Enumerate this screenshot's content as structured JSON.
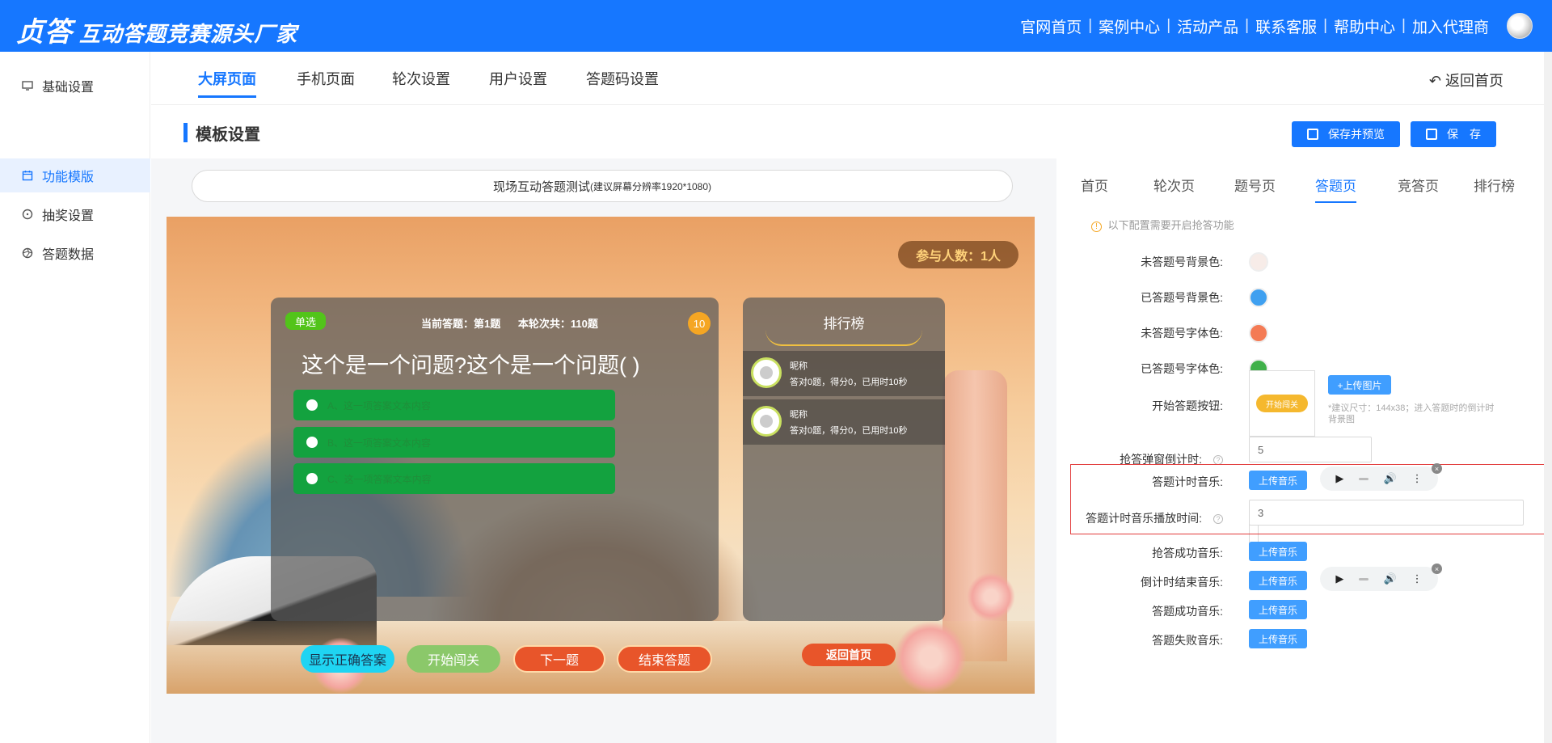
{
  "header": {
    "brand": "贞答",
    "slogan": "互动答题竞赛源头厂家",
    "nav": [
      "官网首页",
      "案例中心",
      "活动产品",
      "联系客服",
      "帮助中心",
      "加入代理商"
    ],
    "separator": "|"
  },
  "sidebar": {
    "items": [
      {
        "label": "基础设置",
        "icon": "monitor-icon"
      },
      {
        "label": "功能模版",
        "icon": "calendar-icon"
      },
      {
        "label": "抽奖设置",
        "icon": "dial-icon"
      },
      {
        "label": "答题数据",
        "icon": "aperture-icon"
      }
    ]
  },
  "tabs": [
    "大屏页面",
    "手机页面",
    "轮次设置",
    "用户设置",
    "答题码设置"
  ],
  "back_home": "返回首页",
  "section_title": "模板设置",
  "actions": {
    "save_preview": "保存并预览",
    "save": "保　存"
  },
  "preview": {
    "title": "现场互动答题测试",
    "resolution_hint": "(建议屏幕分辨率1920*1080)",
    "participants": "参与人数：1人",
    "question": {
      "type": "单选",
      "current": "当前答题：第1题",
      "total": "本轮次共：110题",
      "timer": "10",
      "text": "这个是一个问题?这个是一个问题( )",
      "options": [
        "A、这一项答案文本内容",
        "B、这一项答案文本内容",
        "C、这一项答案文本内容"
      ]
    },
    "ranking": {
      "title": "排行榜",
      "rows": [
        {
          "name": "昵称",
          "stats": "答对0题，得分0，已用时10秒"
        },
        {
          "name": "昵称",
          "stats": "答对0题，得分0，已用时10秒"
        }
      ]
    },
    "buttons": {
      "show_answer": "显示正确答案",
      "start": "开始闯关",
      "next": "下一题",
      "end": "结束答题",
      "return_home": "返回首页"
    }
  },
  "settings": {
    "tabs": [
      "首页",
      "轮次页",
      "题号页",
      "答题页",
      "竞答页",
      "排行榜"
    ],
    "notice": "以下配置需要开启抢答功能",
    "fields": {
      "unanswered_bg": {
        "label": "未答题号背景色:",
        "color": "#f7ece8"
      },
      "answered_bg": {
        "label": "已答题号背景色:",
        "color": "#3fa0f0"
      },
      "unanswered_font": {
        "label": "未答题号字体色:",
        "color": "#f47b55"
      },
      "answered_font": {
        "label": "已答题号字体色:",
        "color": "#3fb049"
      },
      "start_button": {
        "label": "开始答题按钮:",
        "preview_text": "开始闯关",
        "upload": "+上传图片",
        "hint": "*建议尺寸：144x38；进入答题时的倒计时背景图"
      },
      "popup_countdown": {
        "label": "抢答弹窗倒计时:",
        "value": "5"
      },
      "timer_music": {
        "label": "答题计时音乐:",
        "upload": "上传音乐"
      },
      "timer_music_time": {
        "label": "答题计时音乐播放时间:",
        "value": "3"
      },
      "grab_success_music": {
        "label": "抢答成功音乐:",
        "upload": "上传音乐"
      },
      "countdown_end_music": {
        "label": "倒计时结束音乐:",
        "upload": "上传音乐"
      },
      "answer_success_music": {
        "label": "答题成功音乐:",
        "upload": "上传音乐"
      },
      "answer_fail_music": {
        "label": "答题失败音乐:",
        "upload": "上传音乐"
      }
    },
    "player": {
      "play": "▶",
      "volume": "🔊",
      "more": "⋮",
      "close": "×"
    }
  }
}
